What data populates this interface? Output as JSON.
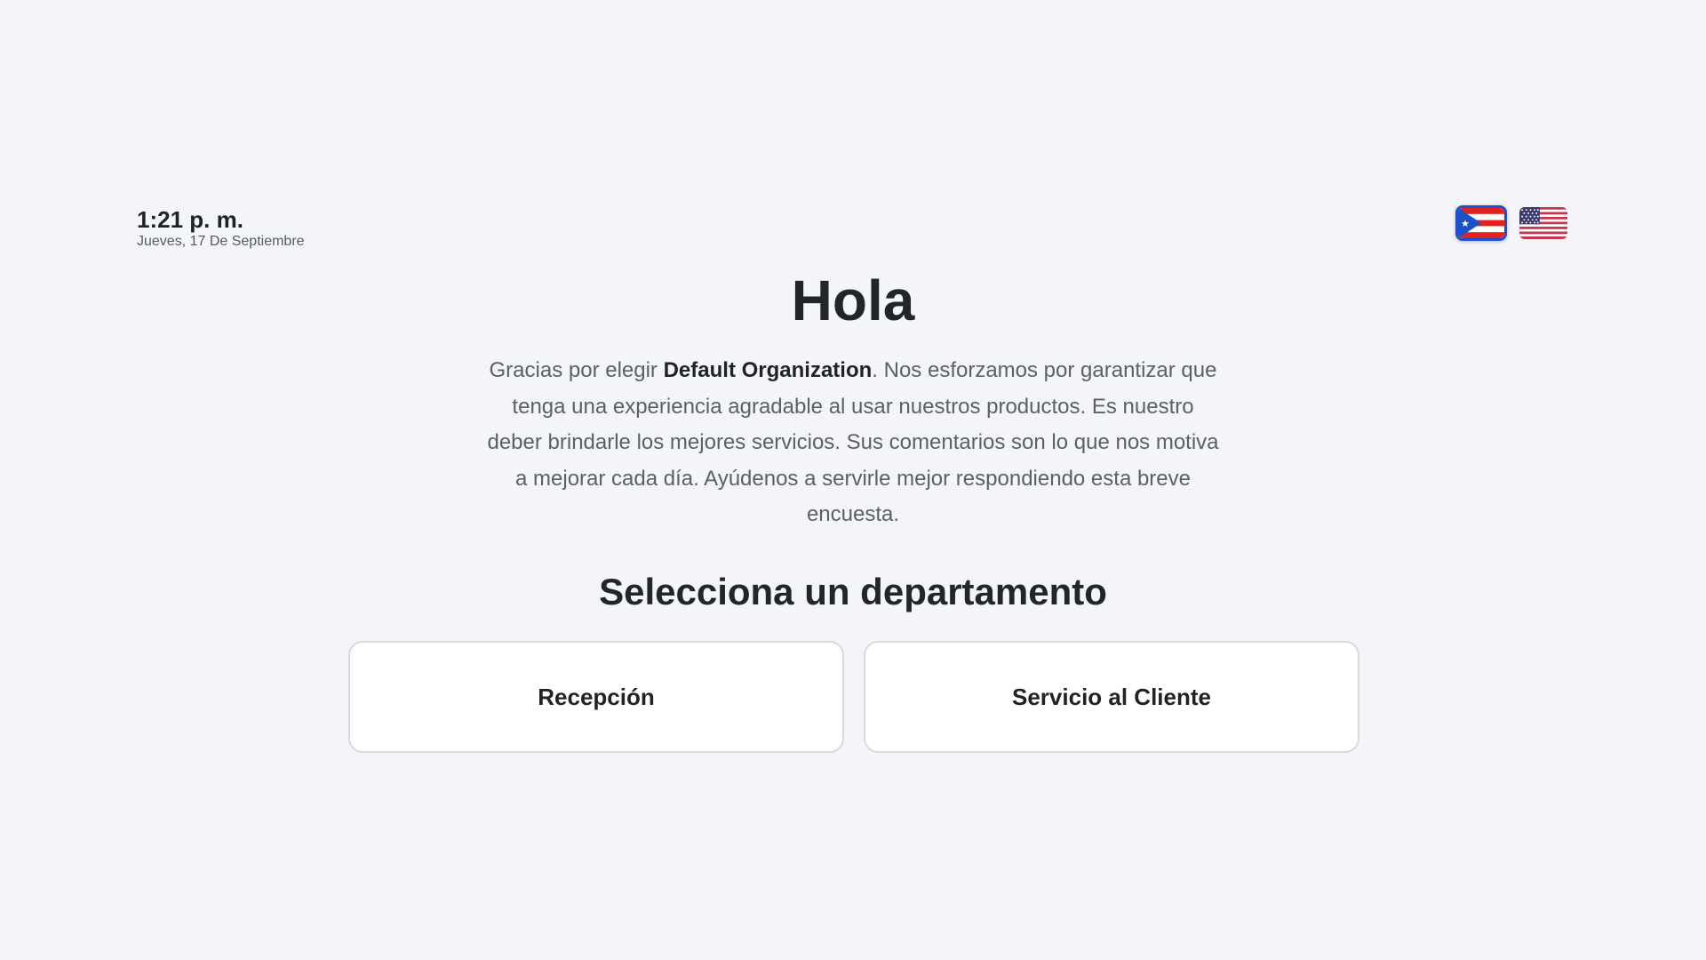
{
  "clock": {
    "time": "1:21 p. m.",
    "date": "Jueves, 17 De Septiembre"
  },
  "languages": [
    {
      "icon": "puerto-rico-flag-icon",
      "active": true
    },
    {
      "icon": "united-states-flag-icon",
      "active": false
    }
  ],
  "greeting": "Hola",
  "intro": {
    "before": "Gracias por elegir ",
    "organization": "Default Organization",
    "after": ". Nos esforzamos por garantizar que tenga una experiencia agradable al usar nuestros productos. Es nuestro deber brindarle los mejores servicios. Sus comentarios son lo que nos motiva a mejorar cada día. Ayúdenos a servirle mejor respondiendo esta breve encuesta."
  },
  "section_title": "Selecciona un departamento",
  "departments": [
    {
      "label": "Recepción"
    },
    {
      "label": "Servicio al Cliente"
    }
  ],
  "colors": {
    "background": "#f4f5f9",
    "active_flag_border": "#1f4fd1",
    "card_border": "#d7d9de"
  }
}
